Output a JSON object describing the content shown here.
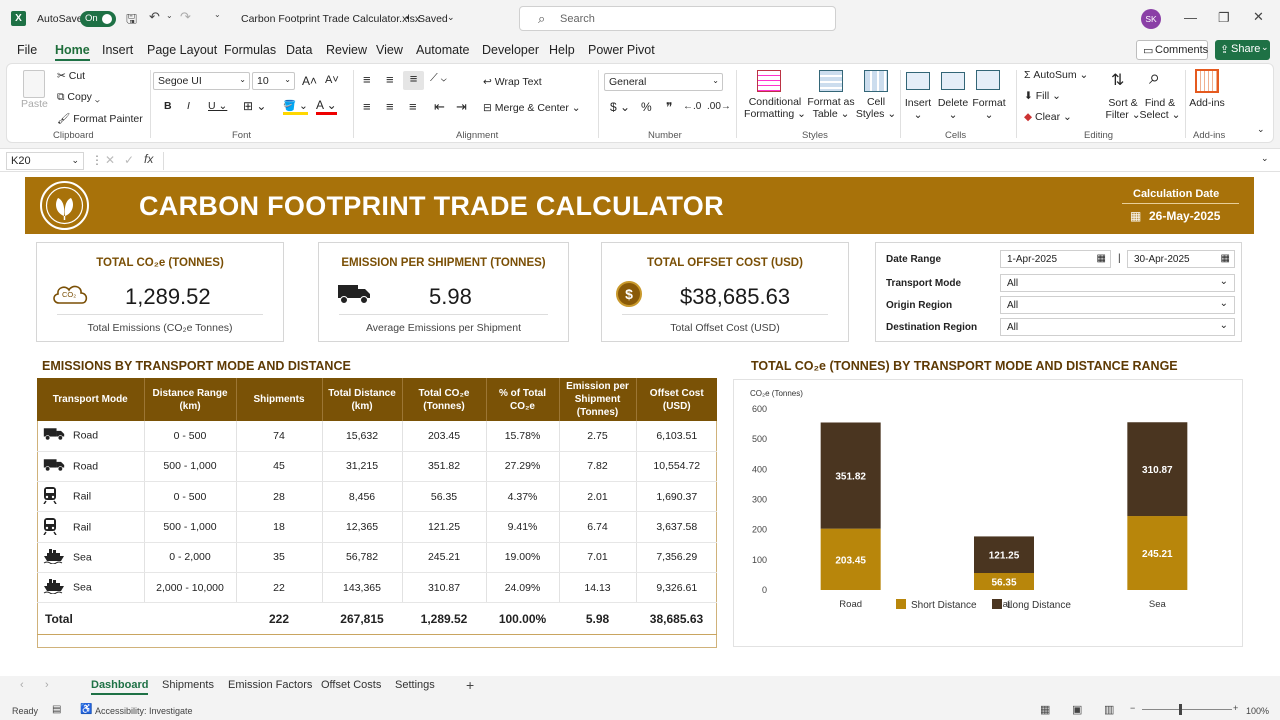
{
  "titlebar": {
    "autosave_label": "AutoSave",
    "autosave_state": "On",
    "file_title": "Carbon Footprint Trade Calculator.xlsx",
    "saved_label": "Saved",
    "search_placeholder": "Search",
    "user_initials": "SK"
  },
  "menu": [
    "File",
    "Home",
    "Insert",
    "Page Layout",
    "Formulas",
    "Data",
    "Review",
    "View",
    "Automate",
    "Developer",
    "Help",
    "Power Pivot"
  ],
  "menu_right": {
    "comments": "Comments",
    "share": "Share"
  },
  "ribbon": {
    "clipboard": {
      "paste": "Paste",
      "cut": "Cut",
      "copy": "Copy",
      "format_painter": "Format Painter",
      "label": "Clipboard"
    },
    "font": {
      "family": "Segoe UI",
      "size": "10",
      "label": "Font"
    },
    "alignment": {
      "wrap": "Wrap Text",
      "merge": "Merge & Center",
      "label": "Alignment"
    },
    "number": {
      "format": "General",
      "label": "Number"
    },
    "styles": {
      "cond": "Conditional Formatting",
      "table": "Format as Table",
      "cell": "Cell Styles",
      "label": "Styles"
    },
    "cells": {
      "insert": "Insert",
      "delete": "Delete",
      "format": "Format",
      "label": "Cells"
    },
    "editing": {
      "autosum": "AutoSum",
      "fill": "Fill",
      "clear": "Clear",
      "sort": "Sort & Filter",
      "find": "Find & Select",
      "label": "Editing"
    },
    "addins": {
      "btn": "Add-ins",
      "label": "Add-ins"
    }
  },
  "formula": {
    "cell_ref": "K20",
    "fx": "fx"
  },
  "banner": {
    "title": "CARBON FOOTPRINT TRADE CALCULATOR",
    "date_label": "Calculation Date",
    "date_value": "26-May-2025"
  },
  "kpis": [
    {
      "title": "TOTAL CO₂e (TONNES)",
      "value": "1,289.52",
      "sub": "Total Emissions (CO₂e Tonnes)",
      "icon": "cloud-co2-icon",
      "icon_text": "CO₂"
    },
    {
      "title": "EMISSION PER SHIPMENT (TONNES)",
      "value": "5.98",
      "sub": "Average Emissions per Shipment",
      "icon": "truck-icon"
    },
    {
      "title": "TOTAL OFFSET COST (USD)",
      "value": "$38,685.63",
      "sub": "Total Offset Cost (USD)",
      "icon": "dollar-coin-icon",
      "icon_text": "$"
    }
  ],
  "filters": {
    "date_range_label": "Date Range",
    "date_from": "1-Apr-2025",
    "date_to": "30-Apr-2025",
    "transport_label": "Transport Mode",
    "transport_value": "All",
    "origin_label": "Origin Region",
    "origin_value": "All",
    "dest_label": "Destination Region",
    "dest_value": "All"
  },
  "table": {
    "title": "EMISSIONS BY TRANSPORT MODE AND DISTANCE",
    "headers": [
      "Transport Mode",
      "Distance Range (km)",
      "Shipments",
      "Total Distance (km)",
      "Total CO₂e (Tonnes)",
      "% of Total CO₂e",
      "Emission per Shipment (Tonnes)",
      "Offset Cost (USD)"
    ],
    "rows": [
      {
        "icon": "truck-icon",
        "mode": "Road",
        "range": "0 - 500",
        "shipments": "74",
        "distance": "15,632",
        "co2": "203.45",
        "pct": "15.78%",
        "per": "2.75",
        "cost": "6,103.51"
      },
      {
        "icon": "truck-icon",
        "mode": "Road",
        "range": "500 - 1,000",
        "shipments": "45",
        "distance": "31,215",
        "co2": "351.82",
        "pct": "27.29%",
        "per": "7.82",
        "cost": "10,554.72"
      },
      {
        "icon": "train-icon",
        "mode": "Rail",
        "range": "0 - 500",
        "shipments": "28",
        "distance": "8,456",
        "co2": "56.35",
        "pct": "4.37%",
        "per": "2.01",
        "cost": "1,690.37"
      },
      {
        "icon": "train-icon",
        "mode": "Rail",
        "range": "500 - 1,000",
        "shipments": "18",
        "distance": "12,365",
        "co2": "121.25",
        "pct": "9.41%",
        "per": "6.74",
        "cost": "3,637.58"
      },
      {
        "icon": "ship-icon",
        "mode": "Sea",
        "range": "0 - 2,000",
        "shipments": "35",
        "distance": "56,782",
        "co2": "245.21",
        "pct": "19.00%",
        "per": "7.01",
        "cost": "7,356.29"
      },
      {
        "icon": "ship-icon",
        "mode": "Sea",
        "range": "2,000 - 10,000",
        "shipments": "22",
        "distance": "143,365",
        "co2": "310.87",
        "pct": "24.09%",
        "per": "14.13",
        "cost": "9,326.61"
      }
    ],
    "total": {
      "label": "Total",
      "shipments": "222",
      "distance": "267,815",
      "co2": "1,289.52",
      "pct": "100.00%",
      "per": "5.98",
      "cost": "38,685.63"
    }
  },
  "chart_data": {
    "type": "bar",
    "stacked": true,
    "title": "TOTAL CO₂e (TONNES) BY TRANSPORT MODE AND DISTANCE RANGE",
    "ylabel": "CO₂e (Tonnes)",
    "xlabel": "",
    "categories": [
      "Road",
      "Rail",
      "Sea"
    ],
    "series": [
      {
        "name": "Short Distance",
        "values": [
          203.45,
          56.35,
          245.21
        ],
        "color": "#b8860b"
      },
      {
        "name": "Long Distance",
        "values": [
          351.82,
          121.25,
          310.87
        ],
        "color": "#4a3520"
      }
    ],
    "ylim": [
      0,
      600
    ],
    "yticks": [
      "0",
      "100",
      "200",
      "300",
      "400",
      "500",
      "600"
    ],
    "grid": false,
    "legend": "bottom"
  },
  "sheets": [
    "Dashboard",
    "Shipments",
    "Emission Factors",
    "Offset Costs",
    "Settings"
  ],
  "status": {
    "ready": "Ready",
    "accessibility": "Accessibility: Investigate",
    "zoom": "100%"
  },
  "colors": {
    "brand_gold": "#a8720a",
    "header_brown": "#7a5206",
    "excel_green": "#1e7145"
  }
}
